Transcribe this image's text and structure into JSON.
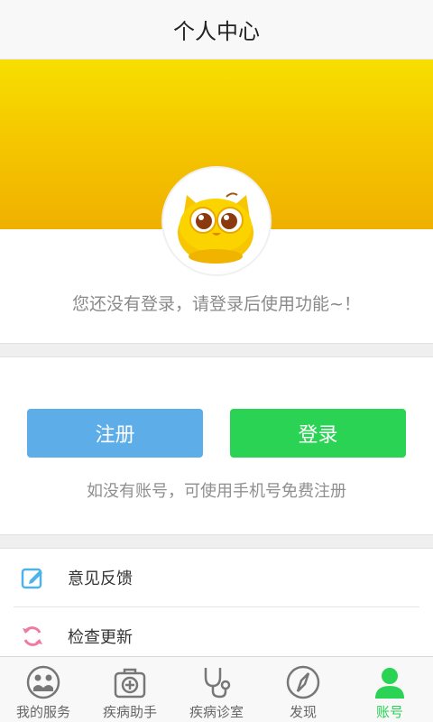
{
  "header": {
    "title": "个人中心"
  },
  "profile": {
    "login_hint": "您还没有登录，请登录后使用功能~！"
  },
  "auth": {
    "register_label": "注册",
    "login_label": "登录",
    "hint": "如没有账号，可使用手机号免费注册"
  },
  "menu": {
    "items": [
      {
        "label": "意见反馈",
        "icon": "edit-icon"
      },
      {
        "label": "检查更新",
        "icon": "refresh-icon"
      }
    ]
  },
  "tabbar": {
    "tabs": [
      {
        "label": "我的服务",
        "icon": "services-icon"
      },
      {
        "label": "疾病助手",
        "icon": "medical-kit-icon"
      },
      {
        "label": "疾病诊室",
        "icon": "stethoscope-icon"
      },
      {
        "label": "发现",
        "icon": "compass-icon"
      },
      {
        "label": "账号",
        "icon": "user-icon",
        "active": true
      }
    ]
  },
  "colors": {
    "banner": "#f5c800",
    "register": "#5dade9",
    "login": "#2ad353",
    "active_tab": "#2ad353"
  }
}
